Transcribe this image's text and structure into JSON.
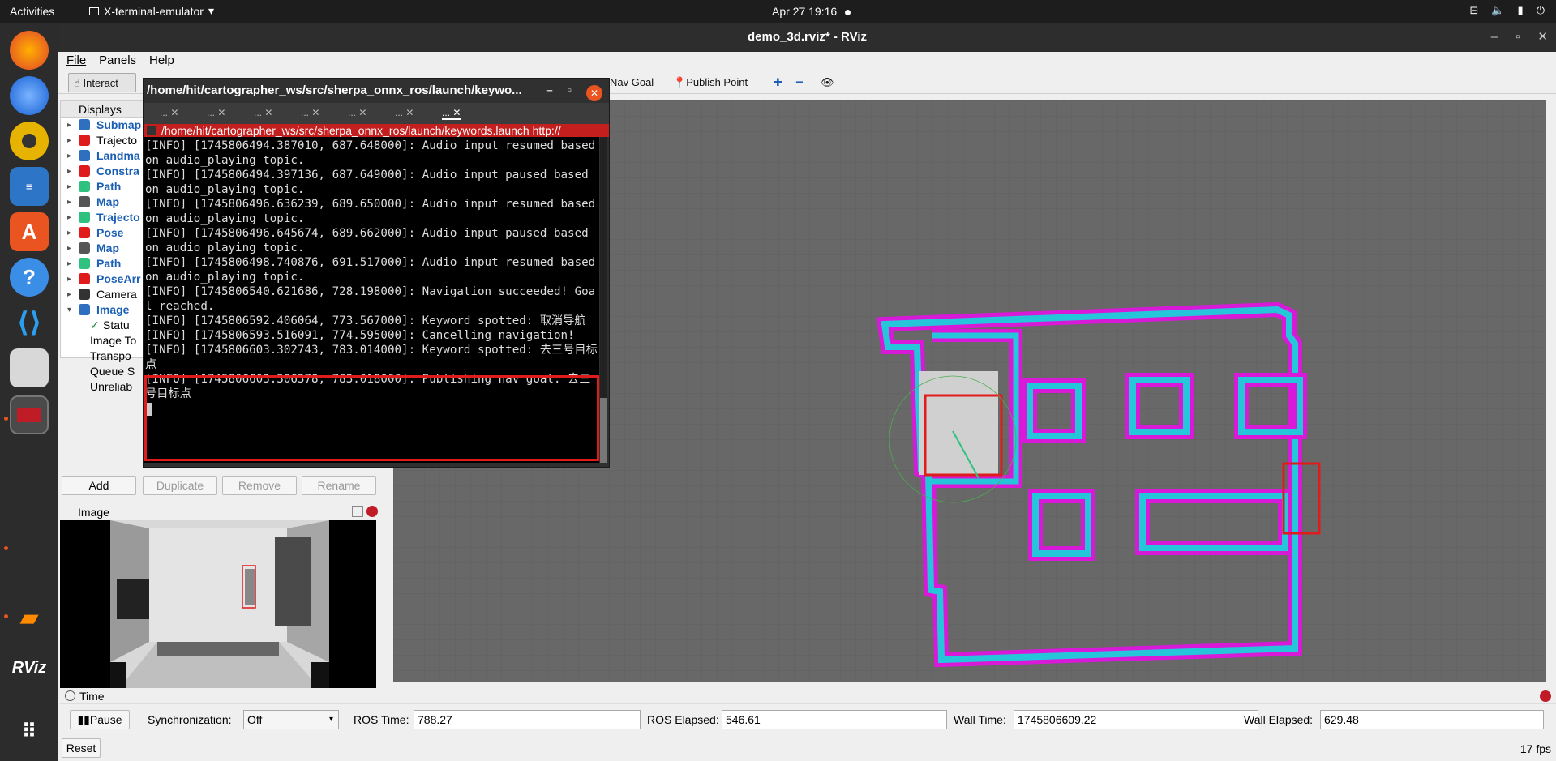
{
  "topbar": {
    "activities": "Activities",
    "app_name": "X-terminal-emulator",
    "clock": "Apr 27  19:16"
  },
  "dock": {
    "icons": [
      "firefox-icon",
      "thunderbird-icon",
      "rhythmbox-icon",
      "writer-icon",
      "app-center-icon",
      "help-icon",
      "vscode-icon",
      "files-icon",
      "terminal-icon",
      "sublime-icon",
      "rviz-icon",
      "apps-grid-icon"
    ],
    "rviz_label": "RViz"
  },
  "rviz": {
    "title": "demo_3d.rviz* - RViz",
    "menu": [
      "File",
      "Panels",
      "Help"
    ],
    "toolbar": {
      "interact": "Interact",
      "nav_goal": "Nav Goal",
      "publish_point": "Publish Point"
    },
    "displays": {
      "title": "Displays",
      "items": [
        {
          "label": "Submap",
          "blue": true,
          "arrow": "▸"
        },
        {
          "label": "Trajecto",
          "blue": false,
          "arrow": "▸"
        },
        {
          "label": "Landma",
          "blue": true,
          "arrow": "▸"
        },
        {
          "label": "Constra",
          "blue": true,
          "arrow": "▸"
        },
        {
          "label": "Path",
          "blue": true,
          "arrow": "▸"
        },
        {
          "label": "Map",
          "blue": true,
          "arrow": "▸"
        },
        {
          "label": "Trajecto",
          "blue": true,
          "arrow": "▸"
        },
        {
          "label": "Pose",
          "blue": true,
          "arrow": "▸"
        },
        {
          "label": "Map",
          "blue": true,
          "arrow": "▸"
        },
        {
          "label": "Path",
          "blue": true,
          "arrow": "▸"
        },
        {
          "label": "PoseArr",
          "blue": true,
          "arrow": "▸"
        },
        {
          "label": "Camera",
          "blue": false,
          "arrow": "▸"
        },
        {
          "label": "Image",
          "blue": true,
          "arrow": "▾"
        }
      ],
      "subitems": [
        "Statu",
        "Image To",
        "Transpo",
        "Queue S",
        "Unreliab"
      ]
    },
    "buttons": {
      "add": "Add",
      "duplicate": "Duplicate",
      "remove": "Remove",
      "rename": "Rename"
    },
    "image_panel": {
      "title": "Image"
    },
    "time": {
      "title": "Time",
      "pause": "Pause",
      "sync_label": "Synchronization:",
      "sync_value": "Off",
      "ros_time_label": "ROS Time:",
      "ros_time": "788.27",
      "ros_elapsed_label": "ROS Elapsed:",
      "ros_elapsed": "546.61",
      "wall_time_label": "Wall Time:",
      "wall_time": "1745806609.22",
      "wall_elapsed_label": "Wall Elapsed:",
      "wall_elapsed": "629.48",
      "reset": "Reset",
      "fps": "17 fps"
    }
  },
  "terminal": {
    "title": "/home/hit/cartographer_ws/src/sherpa_onnx_ros/launch/keywo...",
    "tabs": [
      "...",
      "...",
      "...",
      "...",
      "...",
      "...",
      "..."
    ],
    "path": "/home/hit/cartographer_ws/src/sherpa_onnx_ros/launch/keywords.launch http://",
    "lines": [
      "[INFO] [1745806494.387010, 687.648000]: Audio input resumed based on audio_playing topic.",
      "[INFO] [1745806494.397136, 687.649000]: Audio input paused based on audio_playing topic.",
      "[INFO] [1745806496.636239, 689.650000]: Audio input resumed based on audio_playing topic.",
      "[INFO] [1745806496.645674, 689.662000]: Audio input paused based on audio_playing topic.",
      "[INFO] [1745806498.740876, 691.517000]: Audio input resumed based on audio_playing topic.",
      "[INFO] [1745806540.621686, 728.198000]: Navigation succeeded! Goal reached.",
      "[INFO] [1745806592.406064, 773.567000]: Keyword spotted: 取消导航",
      "[INFO] [1745806593.516091, 774.595000]: Cancelling navigation!",
      "[INFO] [1745806603.302743, 783.014000]: Keyword spotted: 去三号目标点",
      "[INFO] [1745806603.306378, 783.018000]: Publishing nav goal: 去三号目标点"
    ]
  }
}
